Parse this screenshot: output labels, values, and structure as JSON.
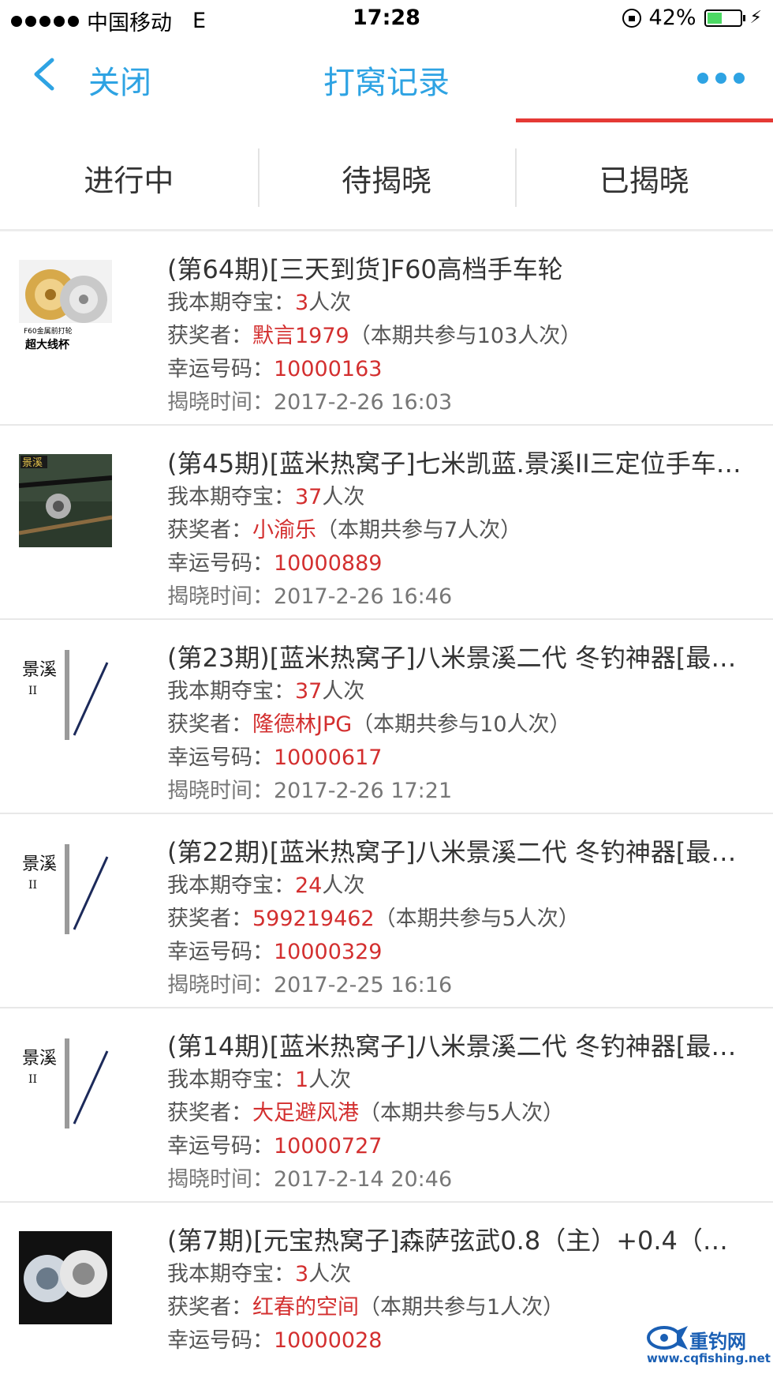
{
  "status_bar": {
    "carrier": "中国移动",
    "network": "E",
    "time": "17:28",
    "battery": "42%"
  },
  "nav": {
    "close_label": "关闭",
    "title": "打窝记录"
  },
  "tabs": [
    {
      "label": "进行中"
    },
    {
      "label": "待揭晓"
    },
    {
      "label": "已揭晓"
    }
  ],
  "labels": {
    "my_buy": "我本期夺宝：",
    "winner": "获奖者：",
    "lucky": "幸运号码：",
    "time": "揭晓时间："
  },
  "items": [
    {
      "title": "(第64期)[三天到货]F60高档手车轮",
      "my_count": "3",
      "unit": "人次",
      "winner": "默言1979",
      "participation": "（本期共参与103人次）",
      "lucky_number": "10000163",
      "reveal_time": "2017-2-26 16:03"
    },
    {
      "title": "(第45期)[蓝米热窝子]七米凯蓝.景溪II三定位手车…",
      "my_count": "37",
      "unit": "人次",
      "winner": "小渝乐",
      "participation": "（本期共参与7人次）",
      "lucky_number": "10000889",
      "reveal_time": "2017-2-26 16:46"
    },
    {
      "title": "(第23期)[蓝米热窝子]八米景溪二代 冬钓神器[最…",
      "my_count": "37",
      "unit": "人次",
      "winner": "隆德林JPG",
      "participation": "（本期共参与10人次）",
      "lucky_number": "10000617",
      "reveal_time": "2017-2-26 17:21"
    },
    {
      "title": "(第22期)[蓝米热窝子]八米景溪二代 冬钓神器[最…",
      "my_count": "24",
      "unit": "人次",
      "winner": "599219462",
      "participation": "（本期共参与5人次）",
      "lucky_number": "10000329",
      "reveal_time": "2017-2-25 16:16"
    },
    {
      "title": "(第14期)[蓝米热窝子]八米景溪二代 冬钓神器[最…",
      "my_count": "1",
      "unit": "人次",
      "winner": "大足避风港",
      "participation": "（本期共参与5人次）",
      "lucky_number": "10000727",
      "reveal_time": "2017-2-14 20:46"
    },
    {
      "title": "(第7期)[元宝热窝子]森萨弦武0.8（主）+0.4（子…",
      "my_count": "3",
      "unit": "人次",
      "winner": "红春的空间",
      "participation": "（本期共参与1人次）",
      "lucky_number": "10000028",
      "reveal_time": ""
    }
  ],
  "thumbs": {
    "reel_caption_1": "F60金属前打轮",
    "reel_caption_2": "超大线杯",
    "rod_caption": "景溪",
    "rod_sub": "II",
    "box_caption": "景溪"
  },
  "watermark": {
    "brand": "重钓网",
    "url": "www.cqfishing.net"
  },
  "colors": {
    "accent": "#2ea3e3",
    "highlight": "#d32f2f",
    "tab_indicator": "#e53935"
  }
}
